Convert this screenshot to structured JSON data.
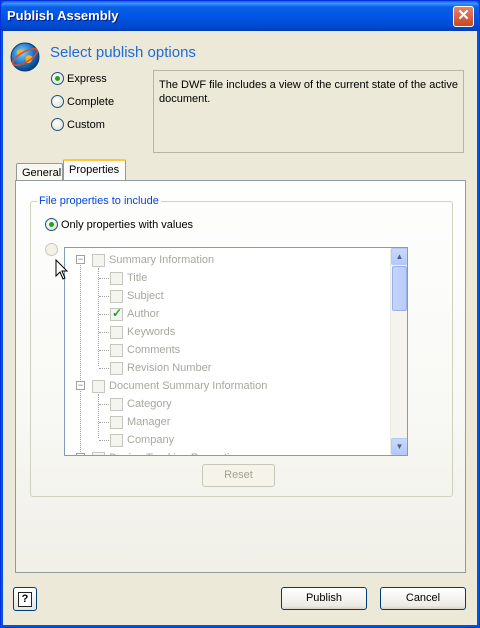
{
  "window": {
    "title": "Publish Assembly",
    "close_glyph": "✕"
  },
  "header": {
    "icon": "globe-icon",
    "heading": "Select publish options"
  },
  "publish_modes": [
    {
      "label": "Express",
      "selected": true
    },
    {
      "label": "Complete",
      "selected": false
    },
    {
      "label": "Custom",
      "selected": false
    }
  ],
  "description": "The DWF file includes a view of the current state of the active document.",
  "tabs": [
    {
      "label": "General",
      "active": false
    },
    {
      "label": "Properties",
      "active": true
    }
  ],
  "properties": {
    "group_label": "File properties to include",
    "only_with_values_label": "Only properties with values",
    "tree": [
      {
        "label": "Summary Information",
        "level": 0,
        "checked": false,
        "expander": "−"
      },
      {
        "label": "Title",
        "level": 1,
        "checked": false
      },
      {
        "label": "Subject",
        "level": 1,
        "checked": false
      },
      {
        "label": "Author",
        "level": 1,
        "checked": true
      },
      {
        "label": "Keywords",
        "level": 1,
        "checked": false
      },
      {
        "label": "Comments",
        "level": 1,
        "checked": false
      },
      {
        "label": "Revision Number",
        "level": 1,
        "checked": false
      },
      {
        "label": "Document Summary Information",
        "level": 0,
        "checked": false,
        "expander": "−"
      },
      {
        "label": "Category",
        "level": 1,
        "checked": false
      },
      {
        "label": "Manager",
        "level": 1,
        "checked": false
      },
      {
        "label": "Company",
        "level": 1,
        "checked": false
      },
      {
        "label": "Design Tracking Properties",
        "level": 0,
        "checked": false,
        "expander": "−"
      }
    ],
    "reset_label": "Reset"
  },
  "footer": {
    "help_glyph": "?",
    "publish_label": "Publish",
    "cancel_label": "Cancel"
  },
  "colors": {
    "accent": "#1E6BD6",
    "title_bar": "#0054E3",
    "check": "#21A121"
  }
}
